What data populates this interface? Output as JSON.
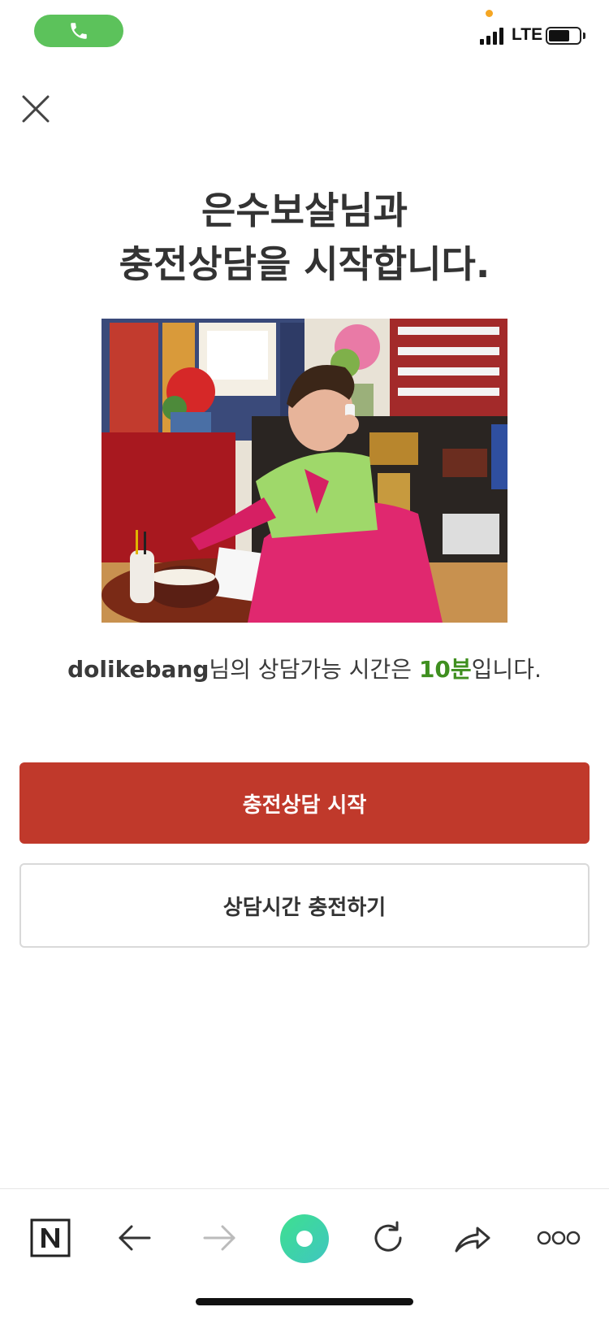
{
  "status_bar": {
    "network_label": "LTE",
    "icons": [
      "phone-icon",
      "signal-icon",
      "battery-icon"
    ]
  },
  "header": {
    "close_icon": "close-icon"
  },
  "title": {
    "line1": "은수보살님과",
    "line2": "충전상담을 시작합니다."
  },
  "photo": {
    "description_icon": "counselor-photo"
  },
  "info": {
    "user": "dolikebang",
    "text_mid": "님의 상담가능 시간은 ",
    "minutes": "10분",
    "text_end": "입니다."
  },
  "buttons": {
    "start_label": "충전상담 시작",
    "charge_label": "상담시간 충전하기"
  },
  "toolbar": {
    "icons": [
      "naver-icon",
      "back-arrow-icon",
      "forward-arrow-icon",
      "home-circle-icon",
      "refresh-icon",
      "share-icon",
      "more-icon"
    ]
  },
  "colors": {
    "primary_button": "#c0392b",
    "minutes_highlight": "#3f8f1f",
    "call_pill": "#5cc25b"
  }
}
